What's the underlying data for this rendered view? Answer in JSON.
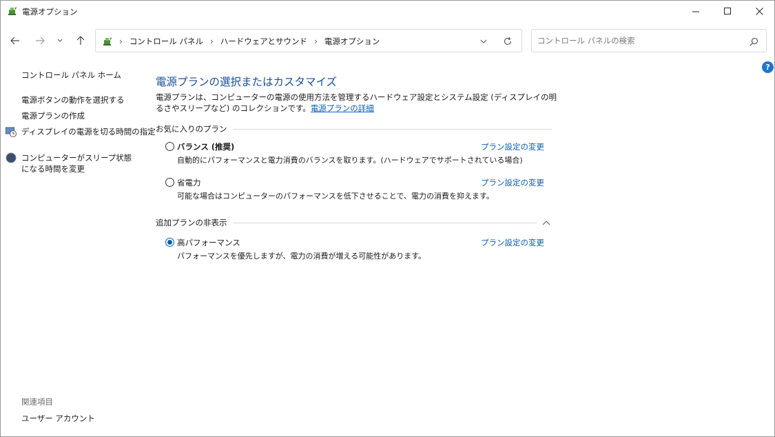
{
  "window": {
    "title": "電源オプション"
  },
  "navbar": {
    "breadcrumbs": [
      "コントロール パネル",
      "ハードウェアとサウンド",
      "電源オプション"
    ],
    "search_placeholder": "コントロール パネルの検索"
  },
  "sidebar": {
    "home": "コントロール パネル ホーム",
    "links": [
      {
        "label": "電源ボタンの動作を選択する",
        "icon": ""
      },
      {
        "label": "電源プランの作成",
        "icon": ""
      },
      {
        "label": "ディスプレイの電源を切る時間の指定",
        "icon": "display-clock-icon"
      },
      {
        "label": "コンピューターがスリープ状態になる時間を変更",
        "icon": "moon-icon"
      }
    ],
    "related_heading": "関連項目",
    "related_links": [
      "ユーザー アカウント"
    ]
  },
  "main": {
    "heading": "電源プランの選択またはカスタマイズ",
    "description": "電源プランは、コンピューターの電源の使用方法を管理するハードウェア設定とシステム設定 (ディスプレイの明るさやスリープなど) のコレクションです。",
    "description_link": "電源プランの詳細",
    "favorites_heading": "お気に入りのプラン",
    "additional_heading": "追加プランの非表示",
    "plans": [
      {
        "name": "バランス (推奨)",
        "description": "自動的にパフォーマンスと電力消費のバランスを取ります。(ハードウェアでサポートされている場合)",
        "change_label": "プラン設定の変更",
        "selected": false
      },
      {
        "name": "省電力",
        "description": "可能な場合はコンピューターのパフォーマンスを低下させることで、電力の消費を抑えます。",
        "change_label": "プラン設定の変更",
        "selected": false
      },
      {
        "name": "高パフォーマンス",
        "description": "パフォーマンスを優先しますが、電力の消費が増える可能性があります。",
        "change_label": "プラン設定の変更",
        "selected": true
      }
    ]
  },
  "colors": {
    "heading": "#1a4f9c",
    "link": "#0b5fb8",
    "radio_selected": "#0a5eb8"
  }
}
